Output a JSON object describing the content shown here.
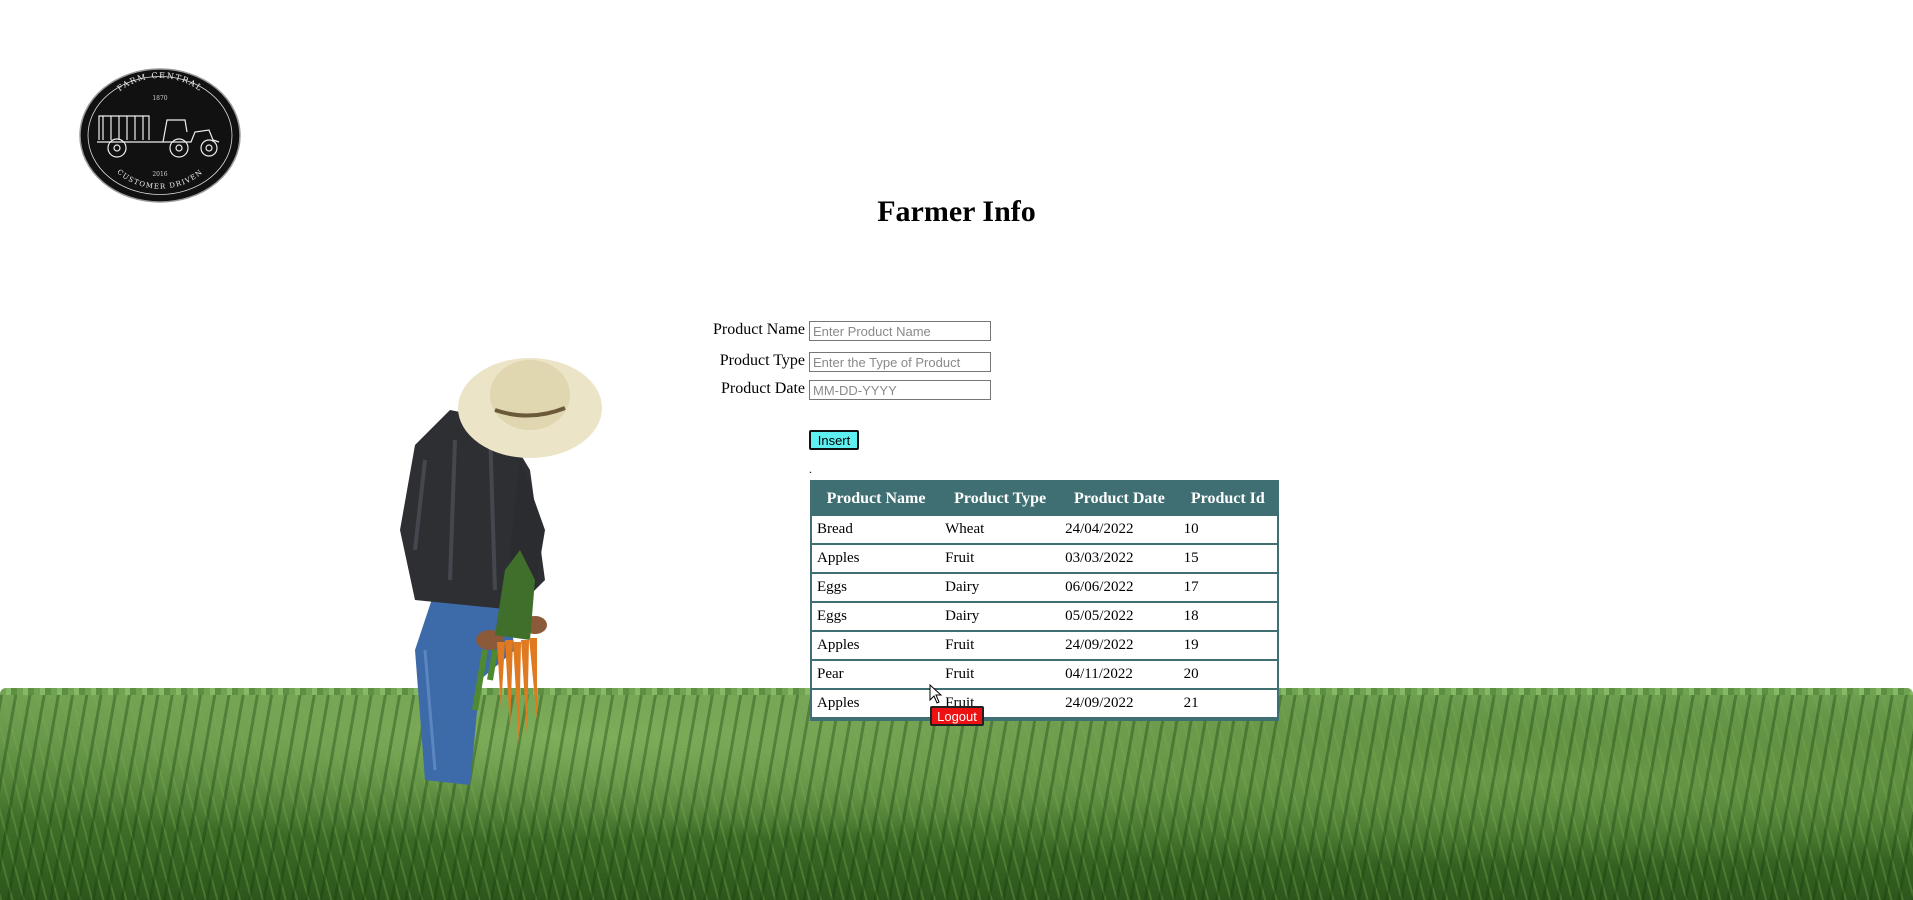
{
  "page": {
    "title": "Farmer Info"
  },
  "logo": {
    "top_text": "FARM CENTRAL",
    "year_top": "1870",
    "year_bottom": "2016",
    "bottom_text": "CUSTOMER DRIVEN"
  },
  "form": {
    "product_name": {
      "label": "Product Name",
      "placeholder": "Enter Product Name"
    },
    "product_type": {
      "label": "Product Type",
      "placeholder": "Enter the Type of Product"
    },
    "product_date": {
      "label": "Product Date",
      "placeholder": "MM-DD-YYYY"
    },
    "insert_label": "Insert",
    "separator": "."
  },
  "table": {
    "headers": [
      "Product Name",
      "Product Type",
      "Product Date",
      "Product Id"
    ],
    "rows": [
      [
        "Bread",
        "Wheat",
        "24/04/2022",
        "10"
      ],
      [
        "Apples",
        "Fruit",
        "03/03/2022",
        "15"
      ],
      [
        "Eggs",
        "Dairy",
        "06/06/2022",
        "17"
      ],
      [
        "Eggs",
        "Dairy",
        "05/05/2022",
        "18"
      ],
      [
        "Apples",
        "Fruit",
        "24/09/2022",
        "19"
      ],
      [
        "Pear",
        "Fruit",
        "04/11/2022",
        "20"
      ],
      [
        "Apples",
        "Fruit",
        "24/09/2022",
        "21"
      ]
    ]
  },
  "logout_label": "Logout",
  "colors": {
    "table_header": "#3f6f73",
    "insert_button": "#5ef0f0",
    "logout_button": "#ee1111"
  }
}
